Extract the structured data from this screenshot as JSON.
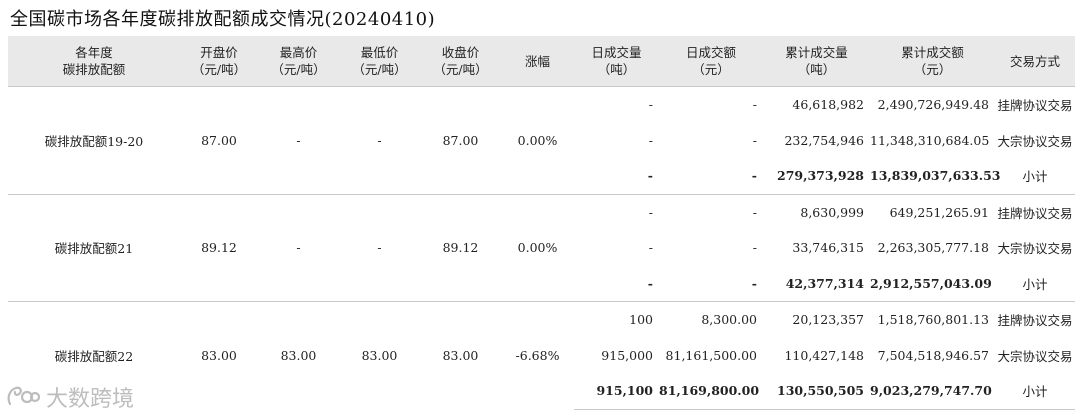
{
  "title": "全国碳市场各年度碳排放配额成交情况(20240410)",
  "headers": [
    [
      "各年度",
      "碳排放配额"
    ],
    [
      "开盘价",
      "（元/吨）"
    ],
    [
      "最高价",
      "（元/吨）"
    ],
    [
      "最低价",
      "（元/吨）"
    ],
    [
      "收盘价",
      "（元/吨）"
    ],
    [
      "涨幅"
    ],
    [
      "日成交量",
      "（吨）"
    ],
    [
      "日成交额",
      "（元）"
    ],
    [
      "累计成交量",
      "（吨）"
    ],
    [
      "累计成交额",
      "（元）"
    ],
    [
      "交易方式"
    ]
  ],
  "groups": [
    {
      "name": "碳排放配额19-20",
      "open": "87.00",
      "high": "-",
      "low": "-",
      "close": "87.00",
      "change": "0.00%",
      "rows": [
        {
          "day_vol": "-",
          "day_amt": "-",
          "cum_vol": "46,618,982",
          "cum_amt": "2,490,726,949.48",
          "mode": "挂牌协议交易"
        },
        {
          "day_vol": "-",
          "day_amt": "-",
          "cum_vol": "232,754,946",
          "cum_amt": "11,348,310,684.05",
          "mode": "大宗协议交易"
        },
        {
          "day_vol": "-",
          "day_amt": "-",
          "cum_vol": "279,373,928",
          "cum_amt": "13,839,037,633.53",
          "mode": "小计"
        }
      ]
    },
    {
      "name": "碳排放配额21",
      "open": "89.12",
      "high": "-",
      "low": "-",
      "close": "89.12",
      "change": "0.00%",
      "rows": [
        {
          "day_vol": "-",
          "day_amt": "-",
          "cum_vol": "8,630,999",
          "cum_amt": "649,251,265.91",
          "mode": "挂牌协议交易"
        },
        {
          "day_vol": "-",
          "day_amt": "-",
          "cum_vol": "33,746,315",
          "cum_amt": "2,263,305,777.18",
          "mode": "大宗协议交易"
        },
        {
          "day_vol": "-",
          "day_amt": "-",
          "cum_vol": "42,377,314",
          "cum_amt": "2,912,557,043.09",
          "mode": "小计"
        }
      ]
    },
    {
      "name": "碳排放配额22",
      "open": "83.00",
      "high": "83.00",
      "low": "83.00",
      "close": "83.00",
      "change": "-6.68%",
      "rows": [
        {
          "day_vol": "100",
          "day_amt": "8,300.00",
          "cum_vol": "20,123,357",
          "cum_amt": "1,518,760,801.13",
          "mode": "挂牌协议交易"
        },
        {
          "day_vol": "915,000",
          "day_amt": "81,161,500.00",
          "cum_vol": "110,427,148",
          "cum_amt": "7,504,518,946.57",
          "mode": "大宗协议交易"
        },
        {
          "day_vol": "915,100",
          "day_amt": "81,169,800.00",
          "cum_vol": "130,550,505",
          "cum_amt": "9,023,279,747.70",
          "mode": "小计"
        }
      ]
    }
  ],
  "watermark": "大数跨境"
}
